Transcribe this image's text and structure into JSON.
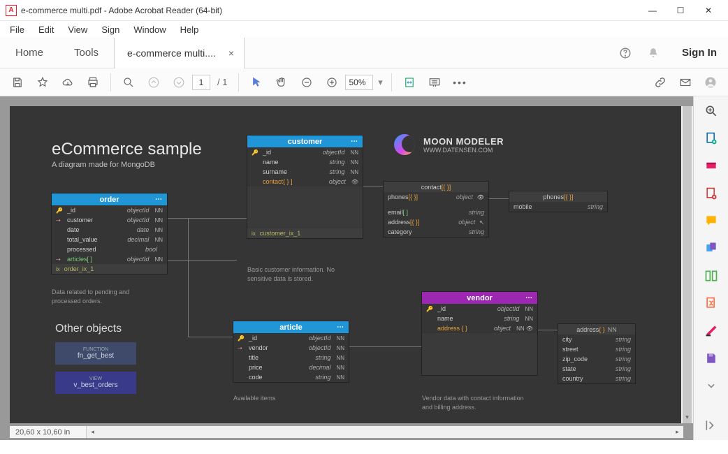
{
  "titlebar": {
    "app_icon": "A",
    "title": "e-commerce multi.pdf - Adobe Acrobat Reader (64-bit)"
  },
  "menubar": {
    "items": [
      "File",
      "Edit",
      "View",
      "Sign",
      "Window",
      "Help"
    ]
  },
  "tabs": {
    "home": "Home",
    "tools": "Tools",
    "doc": "e-commerce multi....",
    "signin": "Sign In"
  },
  "toolbar": {
    "page_current": "1",
    "page_total": "/ 1",
    "zoom": "50%"
  },
  "status": {
    "dims": "20,60 x 10,60 in"
  },
  "diagram": {
    "title": "eCommerce sample",
    "subtitle": "A diagram made for MongoDB",
    "brand": {
      "name": "MOON MODELER",
      "url": "WWW.DATENSEN.COM"
    },
    "other_heading": "Other objects",
    "objects": [
      {
        "type": "FUNCTION",
        "name": "fn_get_best"
      },
      {
        "type": "VIEW",
        "name": "v_best_orders"
      }
    ],
    "captions": {
      "order": "Data related to pending and processed orders.",
      "customer": "Basic customer information. No sensitive data is stored.",
      "article": "Available items",
      "vendor": "Vendor data with contact information and billing address."
    },
    "entities": {
      "order": {
        "title": "order",
        "fields": [
          {
            "ic": "🔑",
            "name": "_id",
            "type": "objectId",
            "nn": "NN"
          },
          {
            "ic": "⇢",
            "name": "customer",
            "type": "objectId",
            "nn": "NN"
          },
          {
            "ic": "",
            "name": "date",
            "type": "date",
            "nn": "NN"
          },
          {
            "ic": "",
            "name": "total_value",
            "type": "decimal",
            "nn": "NN"
          },
          {
            "ic": "",
            "name": "processed",
            "type": "bool",
            "nn": ""
          },
          {
            "ic": "⇢",
            "name": "articles[ ]",
            "type": "objectId",
            "nn": "NN"
          }
        ],
        "index": "order_ix_1"
      },
      "customer": {
        "title": "customer",
        "fields": [
          {
            "ic": "🔑",
            "name": "_id",
            "type": "objectId",
            "nn": "NN"
          },
          {
            "ic": "",
            "name": "name",
            "type": "string",
            "nn": "NN"
          },
          {
            "ic": "",
            "name": "surname",
            "type": "string",
            "nn": "NN"
          },
          {
            "ic": "",
            "name": "contact{ } ]",
            "type": "object",
            "nn": ""
          }
        ],
        "index": "customer_ix_1"
      },
      "article": {
        "title": "article",
        "fields": [
          {
            "ic": "🔑",
            "name": "_id",
            "type": "objectId",
            "nn": "NN"
          },
          {
            "ic": "⇢",
            "name": "vendor",
            "type": "objectId",
            "nn": "NN"
          },
          {
            "ic": "",
            "name": "title",
            "type": "string",
            "nn": "NN"
          },
          {
            "ic": "",
            "name": "price",
            "type": "decimal",
            "nn": "NN"
          },
          {
            "ic": "",
            "name": "code",
            "type": "string",
            "nn": "NN"
          }
        ]
      },
      "vendor": {
        "title": "vendor",
        "fields": [
          {
            "ic": "🔑",
            "name": "_id",
            "type": "objectId",
            "nn": "NN"
          },
          {
            "ic": "",
            "name": "name",
            "type": "string",
            "nn": "NN"
          },
          {
            "ic": "",
            "name": "address { }",
            "type": "object",
            "nn": "NN"
          }
        ]
      },
      "contact": {
        "title": "contact [{ }]",
        "fields": [
          {
            "name": "phones[{ }]",
            "type": "object"
          },
          {
            "name": "email[ ]",
            "type": "string"
          },
          {
            "name": "address[{ }]",
            "type": "object"
          },
          {
            "name": "category",
            "type": "string"
          }
        ]
      },
      "phones": {
        "title": "phones [{ }]",
        "fields": [
          {
            "name": "mobile",
            "type": "string"
          }
        ]
      },
      "address": {
        "title": "address { } NN",
        "fields": [
          {
            "name": "city",
            "type": "string"
          },
          {
            "name": "street",
            "type": "string"
          },
          {
            "name": "zip_code",
            "type": "string"
          },
          {
            "name": "state",
            "type": "string"
          },
          {
            "name": "country",
            "type": "string"
          }
        ]
      }
    }
  }
}
